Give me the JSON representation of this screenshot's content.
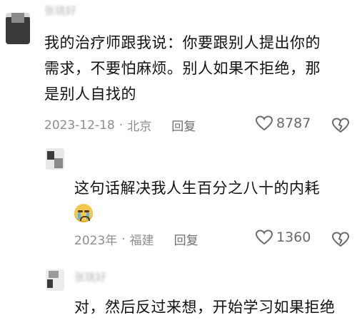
{
  "comments": [
    {
      "username": "张珧好",
      "text_lines": [
        "我的治疗师跟我说：你要跟别人提出你的",
        "需求，不要怕麻烦。别人如果不拒绝，那",
        "是别人自找的"
      ],
      "date": "2023-12-18",
      "location": "北京",
      "reply_label": "回复",
      "likes": "8787"
    },
    {
      "username": "",
      "text_lines": [
        "这句话解决我人生百分之八十的内耗"
      ],
      "emoji": "crying-face",
      "date": "2023年",
      "location": "福建",
      "reply_label": "回复",
      "likes": "1360"
    },
    {
      "username": "张珧好",
      "text_lines": [
        "对，然后反过来想，开始学习如果拒绝"
      ]
    }
  ],
  "separator": "·",
  "colors": {
    "text": "#111111",
    "meta": "#8d8d8d",
    "icon": "#6a6a6a"
  }
}
